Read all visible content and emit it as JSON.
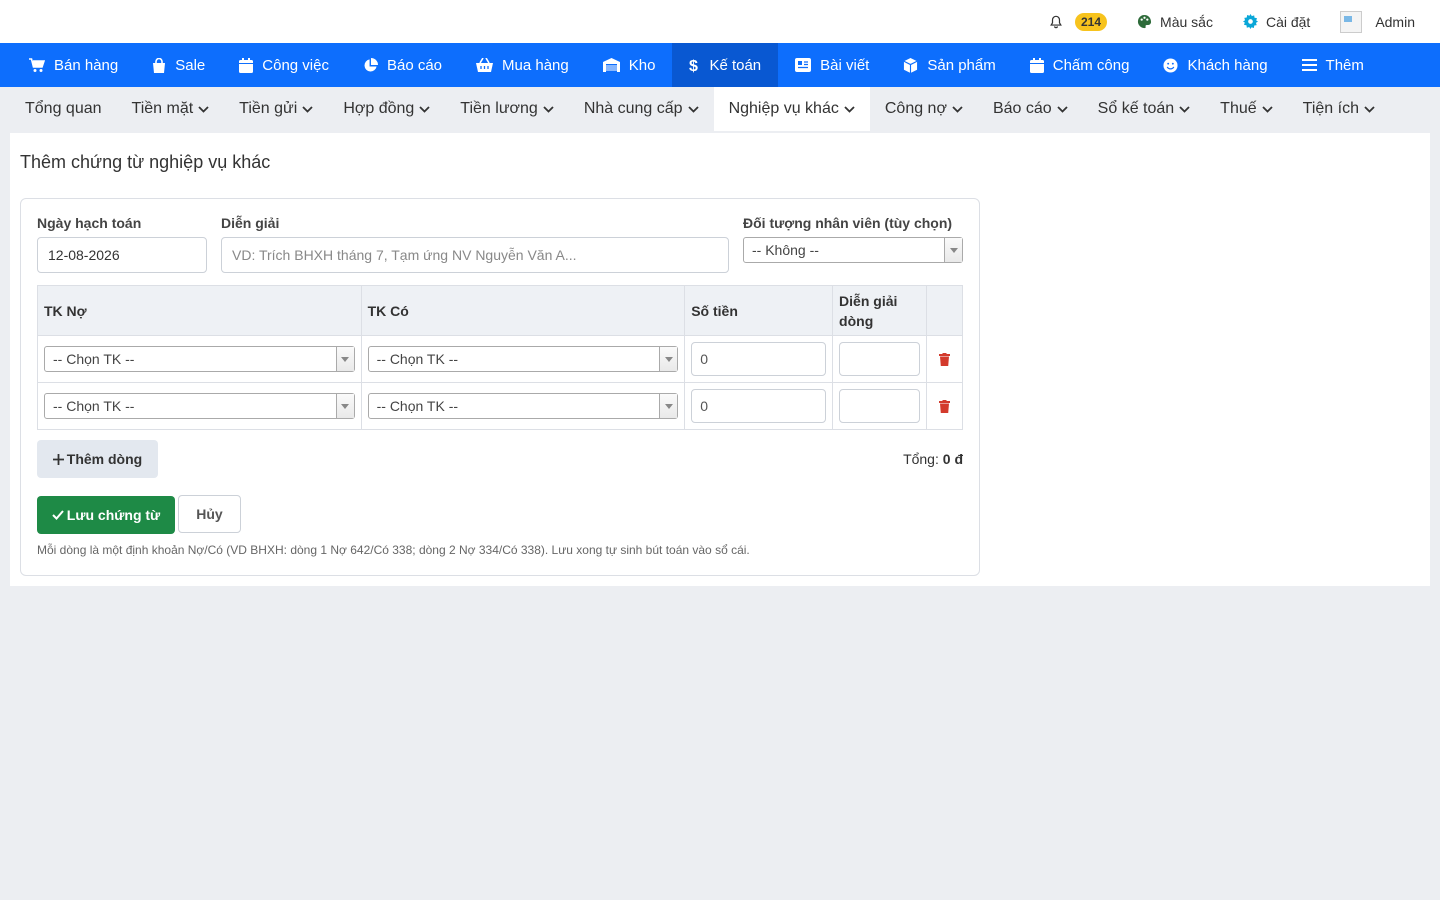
{
  "topbar": {
    "notification_count": "214",
    "colors_label": "Màu sắc",
    "settings_label": "Cài đặt",
    "user_name": "Admin"
  },
  "main_nav": {
    "items": [
      {
        "label": "Bán hàng",
        "icon": "cart-icon"
      },
      {
        "label": "Sale",
        "icon": "bag-icon"
      },
      {
        "label": "Công việc",
        "icon": "calendar-icon"
      },
      {
        "label": "Báo cáo",
        "icon": "pie-chart-icon"
      },
      {
        "label": "Mua hàng",
        "icon": "basket-icon"
      },
      {
        "label": "Kho",
        "icon": "warehouse-icon"
      },
      {
        "label": "Kế toán",
        "icon": "dollar-icon"
      },
      {
        "label": "Bài viết",
        "icon": "newspaper-icon"
      },
      {
        "label": "Sản phẩm",
        "icon": "box-icon"
      },
      {
        "label": "Chấm công",
        "icon": "calendar-icon"
      },
      {
        "label": "Khách hàng",
        "icon": "smile-icon"
      },
      {
        "label": "Thêm",
        "icon": "menu-icon"
      }
    ],
    "active": "Kế toán"
  },
  "sub_nav": {
    "items": [
      {
        "label": "Tổng quan"
      },
      {
        "label": "Tiền mặt"
      },
      {
        "label": "Tiền gửi"
      },
      {
        "label": "Hợp đồng"
      },
      {
        "label": "Tiền lương"
      },
      {
        "label": "Nhà cung cấp"
      },
      {
        "label": "Nghiệp vụ khác"
      },
      {
        "label": "Công nợ"
      },
      {
        "label": "Báo cáo"
      },
      {
        "label": "Sổ kế toán"
      },
      {
        "label": "Thuế"
      },
      {
        "label": "Tiện ích"
      }
    ],
    "active": "Nghiệp vụ khác"
  },
  "page": {
    "title": "Thêm chứng từ nghiệp vụ khác"
  },
  "form": {
    "date_label": "Ngày hạch toán",
    "date_value": "12-08-2026",
    "desc_label": "Diễn giải",
    "desc_placeholder": "VD: Trích BHXH tháng 7, Tạm ứng NV Nguyễn Văn A...",
    "employee_label": "Đối tượng nhân viên (tùy chọn)",
    "employee_value": "-- Không --"
  },
  "table": {
    "headers": {
      "debit": "TK Nợ",
      "credit": "TK Có",
      "amount": "Số tiền",
      "line_desc": "Diễn giải dòng"
    },
    "rows": [
      {
        "debit": "-- Chọn TK --",
        "credit": "-- Chọn TK --",
        "amount": "0",
        "line_desc": ""
      },
      {
        "debit": "-- Chọn TK --",
        "credit": "-- Chọn TK --",
        "amount": "0",
        "line_desc": ""
      }
    ]
  },
  "actions": {
    "add_row": "Thêm dòng",
    "total_label": "Tổng:",
    "total_value": "0 đ",
    "save": "Lưu chứng từ",
    "cancel": "Hủy"
  },
  "hint": "Mỗi dòng là một định khoản Nợ/Có (VD BHXH: dòng 1 Nợ 642/Có 338; dòng 2 Nợ 334/Có 338). Lưu xong tự sinh bút toán vào sổ cái.",
  "colors": {
    "primary": "#0d6efd",
    "primary_active": "#0958d2",
    "success": "#1e8a46",
    "badge": "#f7c31d",
    "danger": "#d33a2c"
  }
}
